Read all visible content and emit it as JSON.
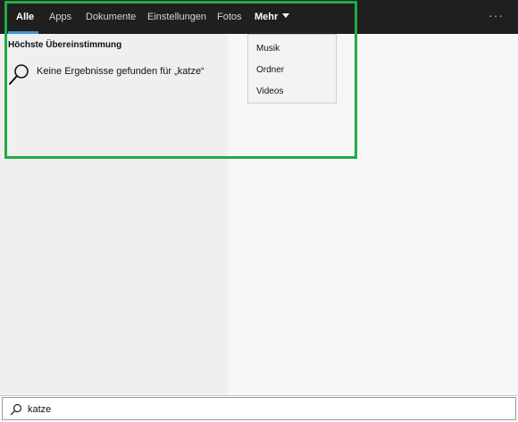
{
  "nav": {
    "tabs": [
      {
        "label": "Alle"
      },
      {
        "label": "Apps"
      },
      {
        "label": "Dokumente"
      },
      {
        "label": "Einstellungen"
      },
      {
        "label": "Fotos"
      }
    ],
    "more_label": "Mehr",
    "overflow_label": "···"
  },
  "dropdown": {
    "items": [
      {
        "label": "Musik"
      },
      {
        "label": "Ordner"
      },
      {
        "label": "Videos"
      }
    ]
  },
  "results": {
    "heading": "Höchste Übereinstimmung",
    "no_results_text": "Keine Ergebnisse gefunden für „katze“"
  },
  "search": {
    "value": "katze"
  },
  "colors": {
    "topbar": "#1f1f1f",
    "accent_underline": "#3a96dd",
    "highlight_border": "#22aa44"
  },
  "icons": {
    "result": "magnifier-icon",
    "search": "search-icon",
    "more": "chevron-down-icon"
  }
}
